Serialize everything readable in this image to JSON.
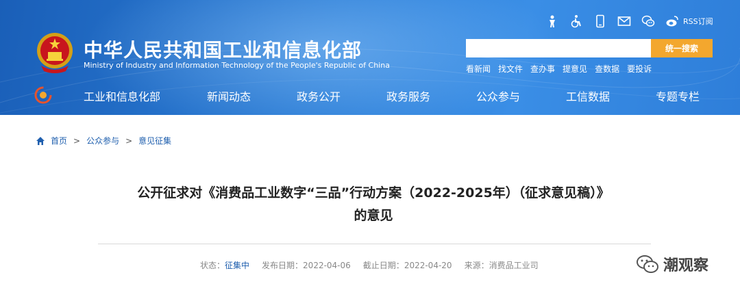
{
  "header": {
    "title_cn": "中华人民共和国工业和信息化部",
    "title_en": "Ministry of Industry and Information Technology of the People's Republic of China",
    "rss_label": "RSS订阅",
    "search": {
      "placeholder": "",
      "button_label": "统一搜索"
    },
    "quick_links": [
      "看新闻",
      "找文件",
      "查办事",
      "提意见",
      "查数据",
      "要投诉"
    ],
    "nav": [
      "工业和信息化部",
      "新闻动态",
      "政务公开",
      "政务服务",
      "公众参与",
      "工信数据",
      "专题专栏"
    ],
    "tool_icons": [
      "elderly-mode-icon",
      "accessibility-icon",
      "mobile-icon",
      "mail-icon",
      "wechat-icon",
      "weibo-icon"
    ]
  },
  "breadcrumb": [
    "首页",
    "公众参与",
    "意见征集"
  ],
  "article": {
    "title_line1": "公开征求对《消费品工业数字“三品”行动方案（2022-2025年）（征求意见稿）》",
    "title_line2": "的意见"
  },
  "meta": {
    "status_label": "状态：",
    "status_value": "征集中",
    "publish_label": "发布日期：",
    "publish_date": "2022-04-06",
    "deadline_label": "截止日期：",
    "deadline_date": "2022-04-20",
    "source_label": "来源：",
    "source_value": "消费品工业司"
  },
  "watermark": {
    "text": "潮观察"
  },
  "colors": {
    "header_blue": "#2d7fd8",
    "search_orange": "#f3a72e",
    "link_blue": "#1f5fae"
  }
}
